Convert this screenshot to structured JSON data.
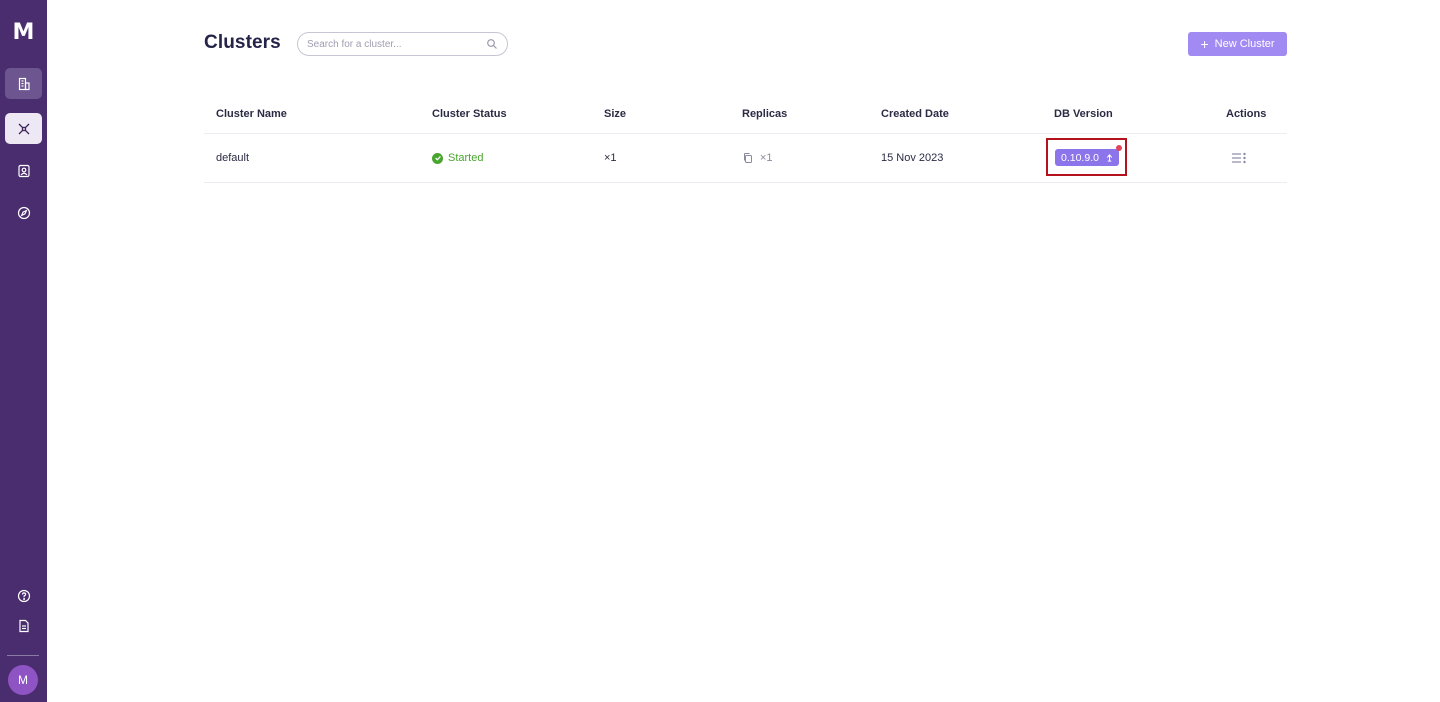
{
  "sidebar": {
    "logo": "M",
    "nav": [
      {
        "icon": "building-icon",
        "active": "dim"
      },
      {
        "icon": "cluster-network-icon",
        "active": "bright"
      },
      {
        "icon": "contacts-icon"
      },
      {
        "icon": "compass-icon"
      }
    ],
    "bottom": [
      {
        "icon": "help-icon"
      },
      {
        "icon": "document-icon"
      }
    ],
    "avatar_initial": "M"
  },
  "header": {
    "title": "Clusters",
    "search_placeholder": "Search for a cluster...",
    "new_button_label": "New Cluster"
  },
  "table": {
    "columns": [
      "Cluster Name",
      "Cluster Status",
      "Size",
      "Replicas",
      "Created Date",
      "DB Version",
      "Actions"
    ],
    "rows": [
      {
        "name": "default",
        "status": "Started",
        "size": "×1",
        "replicas": "×1",
        "created": "15 Nov 2023",
        "db_version": "0.10.9.0"
      }
    ]
  },
  "colors": {
    "sidebar": "#4a2d6e",
    "accent": "#a18bf2",
    "version_pill": "#8c74ea",
    "status_green": "#4aa530",
    "highlight_red": "#b4121d",
    "update_dot": "#e2455a"
  }
}
